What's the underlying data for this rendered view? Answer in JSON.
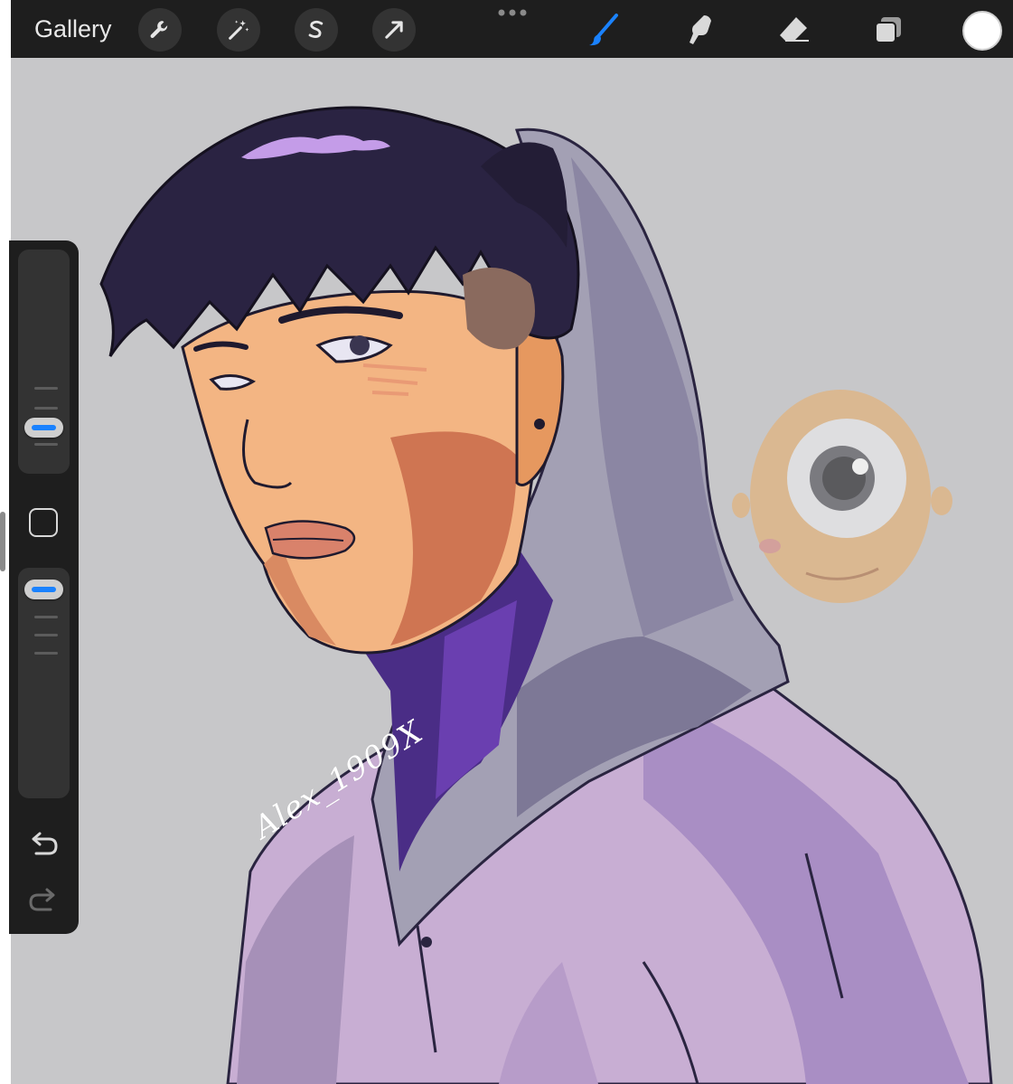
{
  "topbar": {
    "gallery_label": "Gallery",
    "tools_left": [
      "wrench-icon",
      "magic-wand-icon",
      "selection-icon",
      "transform-arrow-icon"
    ],
    "tools_right": [
      "brush-icon",
      "smudge-icon",
      "eraser-icon",
      "layers-icon"
    ],
    "active_tool": "brush-icon",
    "accent_color": "#1a82ff",
    "current_color": "#ffffff"
  },
  "sidebar": {
    "brush_size_level": 0.55,
    "opacity_level": 1.0,
    "buttons": [
      "modify-square-icon",
      "undo-icon",
      "redo-icon"
    ]
  },
  "canvas": {
    "background_color": "#c7c7c9",
    "signature": "Alex_1909X"
  }
}
